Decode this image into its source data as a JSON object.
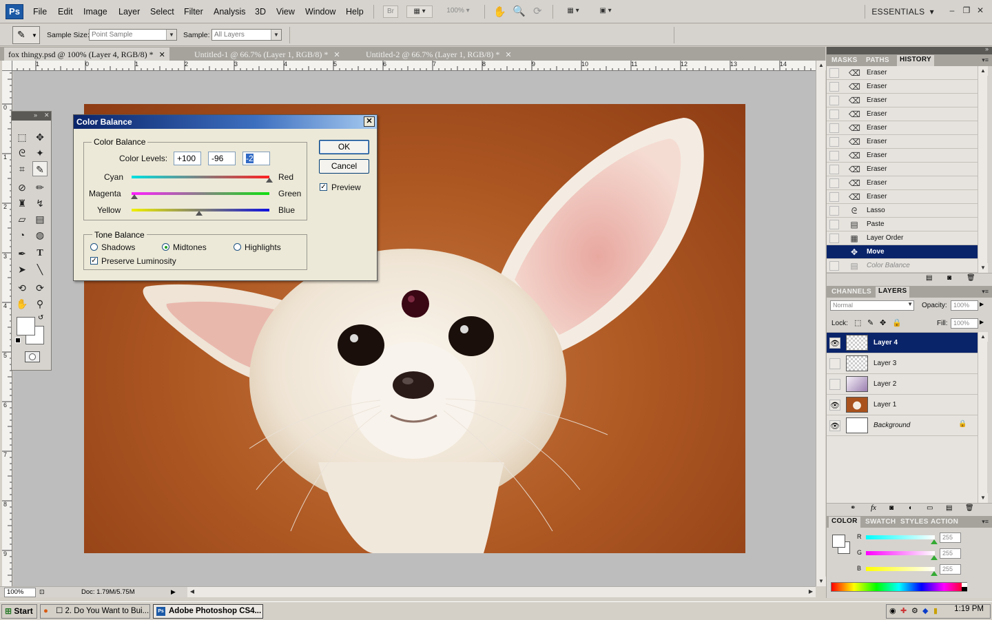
{
  "menubar": {
    "logo": "Ps",
    "items": [
      "File",
      "Edit",
      "Image",
      "Layer",
      "Select",
      "Filter",
      "Analysis",
      "3D",
      "View",
      "Window",
      "Help"
    ],
    "bridge_label": "Br",
    "zoom": "100%",
    "workspace": "ESSENTIALS",
    "window_controls": [
      "–",
      "❐",
      "✕"
    ]
  },
  "options": {
    "sample_size_label": "Sample Size:",
    "sample_size_value": "Point Sample",
    "sample_label": "Sample:",
    "sample_value": "All Layers"
  },
  "tabs": [
    {
      "label": "fox thingy.psd @ 100% (Layer 4, RGB/8) *",
      "active": true
    },
    {
      "label": "Untitled-1 @ 66.7% (Layer 1, RGB/8) *",
      "active": false
    },
    {
      "label": "Untitled-2 @ 66.7% (Layer 1, RGB/8) *",
      "active": false
    }
  ],
  "rulers": {
    "h": [
      "1",
      "0",
      "1",
      "2",
      "3",
      "4",
      "5",
      "6",
      "7",
      "8",
      "9",
      "10",
      "11",
      "12",
      "13",
      "14"
    ],
    "v": [
      "0",
      "1",
      "2",
      "3",
      "4",
      "5",
      "6",
      "7",
      "8",
      "9"
    ]
  },
  "status": {
    "zoom": "100%",
    "doc": "Doc: 1.79M/5.75M"
  },
  "dialog": {
    "title": "Color Balance",
    "group_color": "Color Balance",
    "levels_label": "Color Levels:",
    "levels": [
      "+100",
      "-96",
      "-2"
    ],
    "sliders": [
      {
        "left": "Cyan",
        "right": "Red",
        "value": 100
      },
      {
        "left": "Magenta",
        "right": "Green",
        "value": -96
      },
      {
        "left": "Yellow",
        "right": "Blue",
        "value": -2
      }
    ],
    "group_tone": "Tone Balance",
    "tones": [
      "Shadows",
      "Midtones",
      "Highlights"
    ],
    "selected_tone": "Midtones",
    "preserve": "Preserve Luminosity",
    "ok": "OK",
    "cancel": "Cancel",
    "preview": "Preview"
  },
  "history_panel": {
    "tabs": [
      "MASKS",
      "PATHS",
      "HISTORY"
    ],
    "active_tab": "HISTORY",
    "items": [
      {
        "label": "Eraser",
        "icon": "eraser-icon"
      },
      {
        "label": "Eraser",
        "icon": "eraser-icon"
      },
      {
        "label": "Eraser",
        "icon": "eraser-icon"
      },
      {
        "label": "Eraser",
        "icon": "eraser-icon"
      },
      {
        "label": "Eraser",
        "icon": "eraser-icon"
      },
      {
        "label": "Eraser",
        "icon": "eraser-icon"
      },
      {
        "label": "Eraser",
        "icon": "eraser-icon"
      },
      {
        "label": "Eraser",
        "icon": "eraser-icon"
      },
      {
        "label": "Eraser",
        "icon": "eraser-icon"
      },
      {
        "label": "Eraser",
        "icon": "eraser-icon"
      },
      {
        "label": "Lasso",
        "icon": "lasso-icon"
      },
      {
        "label": "Paste",
        "icon": "paste-icon"
      },
      {
        "label": "Layer Order",
        "icon": "layer-order-icon"
      },
      {
        "label": "Move",
        "icon": "move-icon",
        "selected": true
      },
      {
        "label": "Color Balance",
        "icon": "adjustment-icon",
        "ghost": true
      }
    ]
  },
  "layers_panel": {
    "tabs": [
      "CHANNELS",
      "LAYERS"
    ],
    "active_tab": "LAYERS",
    "blend_mode": "Normal",
    "opacity_label": "Opacity:",
    "opacity": "100%",
    "lock_label": "Lock:",
    "fill_label": "Fill:",
    "fill": "100%",
    "layers": [
      {
        "name": "Layer 4",
        "visible": true,
        "selected": true
      },
      {
        "name": "Layer 3",
        "visible": false
      },
      {
        "name": "Layer 2",
        "visible": false
      },
      {
        "name": "Layer 1",
        "visible": true
      },
      {
        "name": "Background",
        "visible": true,
        "locked": true
      }
    ]
  },
  "color_panel": {
    "tabs": [
      "COLOR",
      "SWATCH",
      "STYLES",
      "ACTION"
    ],
    "active_tab": "COLOR",
    "channels": [
      {
        "label": "R",
        "value": "255"
      },
      {
        "label": "G",
        "value": "255"
      },
      {
        "label": "B",
        "value": "255"
      }
    ]
  },
  "taskbar": {
    "start": "Start",
    "tasks": [
      {
        "label": "☐ 2. Do You Want to Bui...",
        "active": false
      },
      {
        "label": "Adobe Photoshop CS4...",
        "active": true
      }
    ],
    "clock": "1:19 PM"
  },
  "colors": {
    "selection": "#0a246a",
    "panel": "#d6d3ce",
    "canvas_bg": "#bdbdbd",
    "photo_bg": "#b05a24"
  }
}
